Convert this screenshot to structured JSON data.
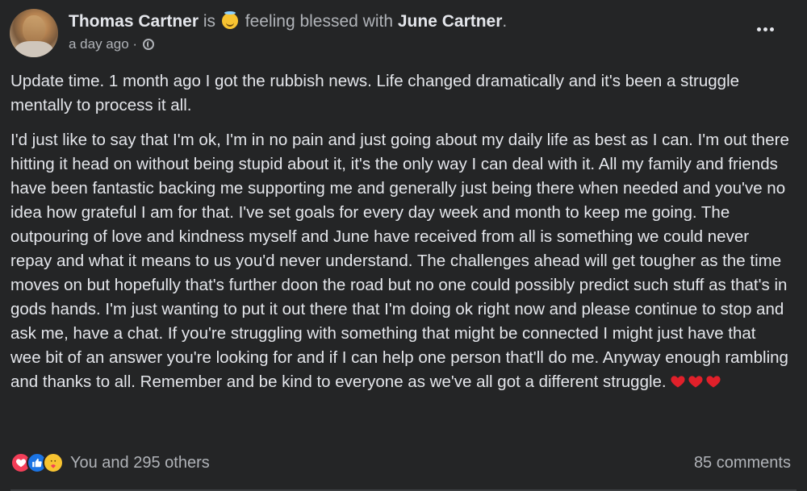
{
  "post": {
    "author": "Thomas Cartner",
    "is_text": "is",
    "feeling_text": "feeling blessed with",
    "tagged": "June Cartner",
    "period": ".",
    "time": "a day ago",
    "separator": "·",
    "privacy_icon": "globe-icon",
    "more_icon": "more-options-icon"
  },
  "content": {
    "paragraph1": "Update time. 1 month ago I got the rubbish news. Life changed dramatically and it's been a struggle mentally to process it all.",
    "paragraph2": "I'd just like to say that I'm ok, I'm in no pain and just going about my daily life as best as I can. I'm out there hitting it head on without being stupid about it, it's the only way I can deal with it. All my family and friends have been fantastic backing me supporting me and generally just being there when needed and you've no idea how grateful I am for that. I've set goals for every day week and month to keep me going. The outpouring of love and kindness myself and June have received from all is something we could never repay and what it means to us you'd never understand. The challenges ahead will get tougher as the time moves on but hopefully that's further doon the road but no one could possibly predict such stuff as that's in gods hands. I'm just wanting to put it out there that I'm doing ok right now and please continue to stop and ask me, have a chat. If you're struggling with something that might be connected I might just have that wee bit of an answer you're looking for and if I can help one person that'll do me. Anyway enough rambling and thanks to all. Remember and be kind to everyone as we've all got a different struggle.",
    "emojis": [
      "heart-emoji",
      "heart-emoji",
      "heart-emoji"
    ]
  },
  "footer": {
    "reaction_icons": [
      "love-reaction-icon",
      "like-reaction-icon",
      "care-reaction-icon"
    ],
    "reactions_text": "You and 295 others",
    "comments_text": "85 comments"
  },
  "colors": {
    "background": "#242526",
    "text_primary": "#e4e6eb",
    "text_secondary": "#b0b3b8",
    "love": "#f33e58",
    "like": "#1b74e4",
    "care": "#f7c331"
  }
}
